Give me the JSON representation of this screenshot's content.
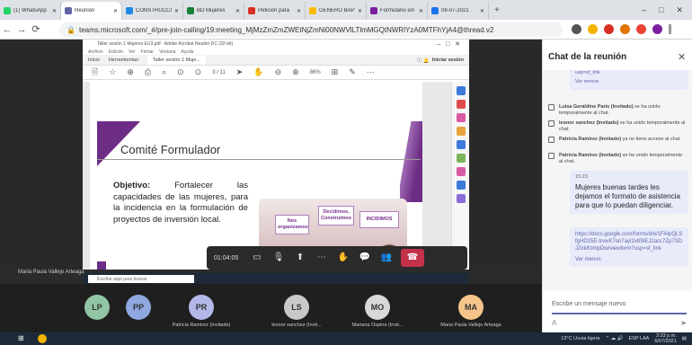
{
  "browser": {
    "tabs": [
      {
        "label": "(1) WhatsApp",
        "color": "#25d366"
      },
      {
        "label": "Reunión",
        "color": "#6264a7",
        "active": true
      },
      {
        "label": "CONSTRUCCI",
        "color": "#1e88e5"
      },
      {
        "label": "BD Mujeres",
        "color": "#188038"
      },
      {
        "label": "Petición para",
        "color": "#d93025"
      },
      {
        "label": "GENERO BAP",
        "color": "#fbbc04"
      },
      {
        "label": "Formulario sin",
        "color": "#7b1fa2"
      },
      {
        "label": "08-07-2021",
        "color": "#1a73e8"
      }
    ],
    "url": "teams.microsoft.com/_#/pre-join-calling/19:meeting_MjMzZmZmZWEtNjZmNi00NWVlLTlmMGQtNWRlYzA0MTFhYjA4@thread.v2"
  },
  "acrobat": {
    "title": "Taller sesión 1 Mujeres EU3.pdf - Adobe Acrobat Reader DC (32-bit)",
    "menu": [
      "Archivo",
      "Edición",
      "Ver",
      "Firmar",
      "Ventana",
      "Ayuda"
    ],
    "tabs": [
      "Inicio",
      "Herramientas",
      "Taller sesión 1 Muje..."
    ],
    "page_indicator": "3 / 11",
    "zoom": "86%",
    "login": "Iniciar sesión"
  },
  "slide": {
    "title": "Comité Formulador",
    "objective_label": "Objetivo:",
    "objective_text": "Fortalecer las capacidades de las mujeres, para la incidencia en la formulación de proyectos de inversión local.",
    "signs": [
      "Nos organizamos",
      "Decidimos, Construimos",
      "INCIDIMOS"
    ]
  },
  "call": {
    "timer": "01:04:05",
    "presenter": "Maria Paula Vallejo Arteaga",
    "search_placeholder": "Escribe aquí para buscar",
    "participants": [
      {
        "initials": "LP",
        "name": "",
        "color": "#92c5a3"
      },
      {
        "initials": "PP",
        "name": "",
        "color": "#8fa8e0"
      },
      {
        "initials": "PR",
        "name": "Patricia Ramirez (Invitado)",
        "color": "#b3b8e8"
      },
      {
        "initials": "LS",
        "name": "leonor sanchez (Invit...",
        "color": "#c8c8c8"
      },
      {
        "initials": "MO",
        "name": "Mariana Ospina (Invit...",
        "color": "#d8d8d8"
      },
      {
        "initials": "MA",
        "name": "Maria Paula Vallejo Arteaga",
        "color": "#f5c48a"
      }
    ]
  },
  "chat": {
    "title": "Chat de la reunión",
    "top_link": "usp=sf_link",
    "see_less_1": "Ver menos",
    "system": [
      {
        "bold": "Luisa Geraldine Paris (Invitado)",
        "text": " se ha unido temporalmente al chat."
      },
      {
        "bold": "leonor sanchez (Invitado)",
        "text": " se ha unido temporalmente al chat."
      },
      {
        "bold": "Patricia Ramirez (Invitado)",
        "text": " ya no tiene acceso al chat."
      },
      {
        "bold": "Patricia Ramirez (Invitado)",
        "text": " se ha unido temporalmente al chat."
      }
    ],
    "message_time": "15:23",
    "message_text": "Mujeres buenas tardes les dejamos el formato de asistencia para que lo puedan diligenciar.",
    "link_text": "https://docs.google.com/forms/d/e/1FAIpQLSfgHD25E-trvwK7on7ayl2v8SlEJ2acc7Zp7SDJZxkKtmlpDw/viewform?usp=sf_link",
    "see_less_2": "Ver menos",
    "input_placeholder": "Escribe un mensaje nuevo"
  },
  "taskbar": {
    "weather": "13°C Lluvia ligera",
    "lang": "ESP LAA",
    "time": "3:23 p.m.",
    "date": "6/07/2021"
  }
}
